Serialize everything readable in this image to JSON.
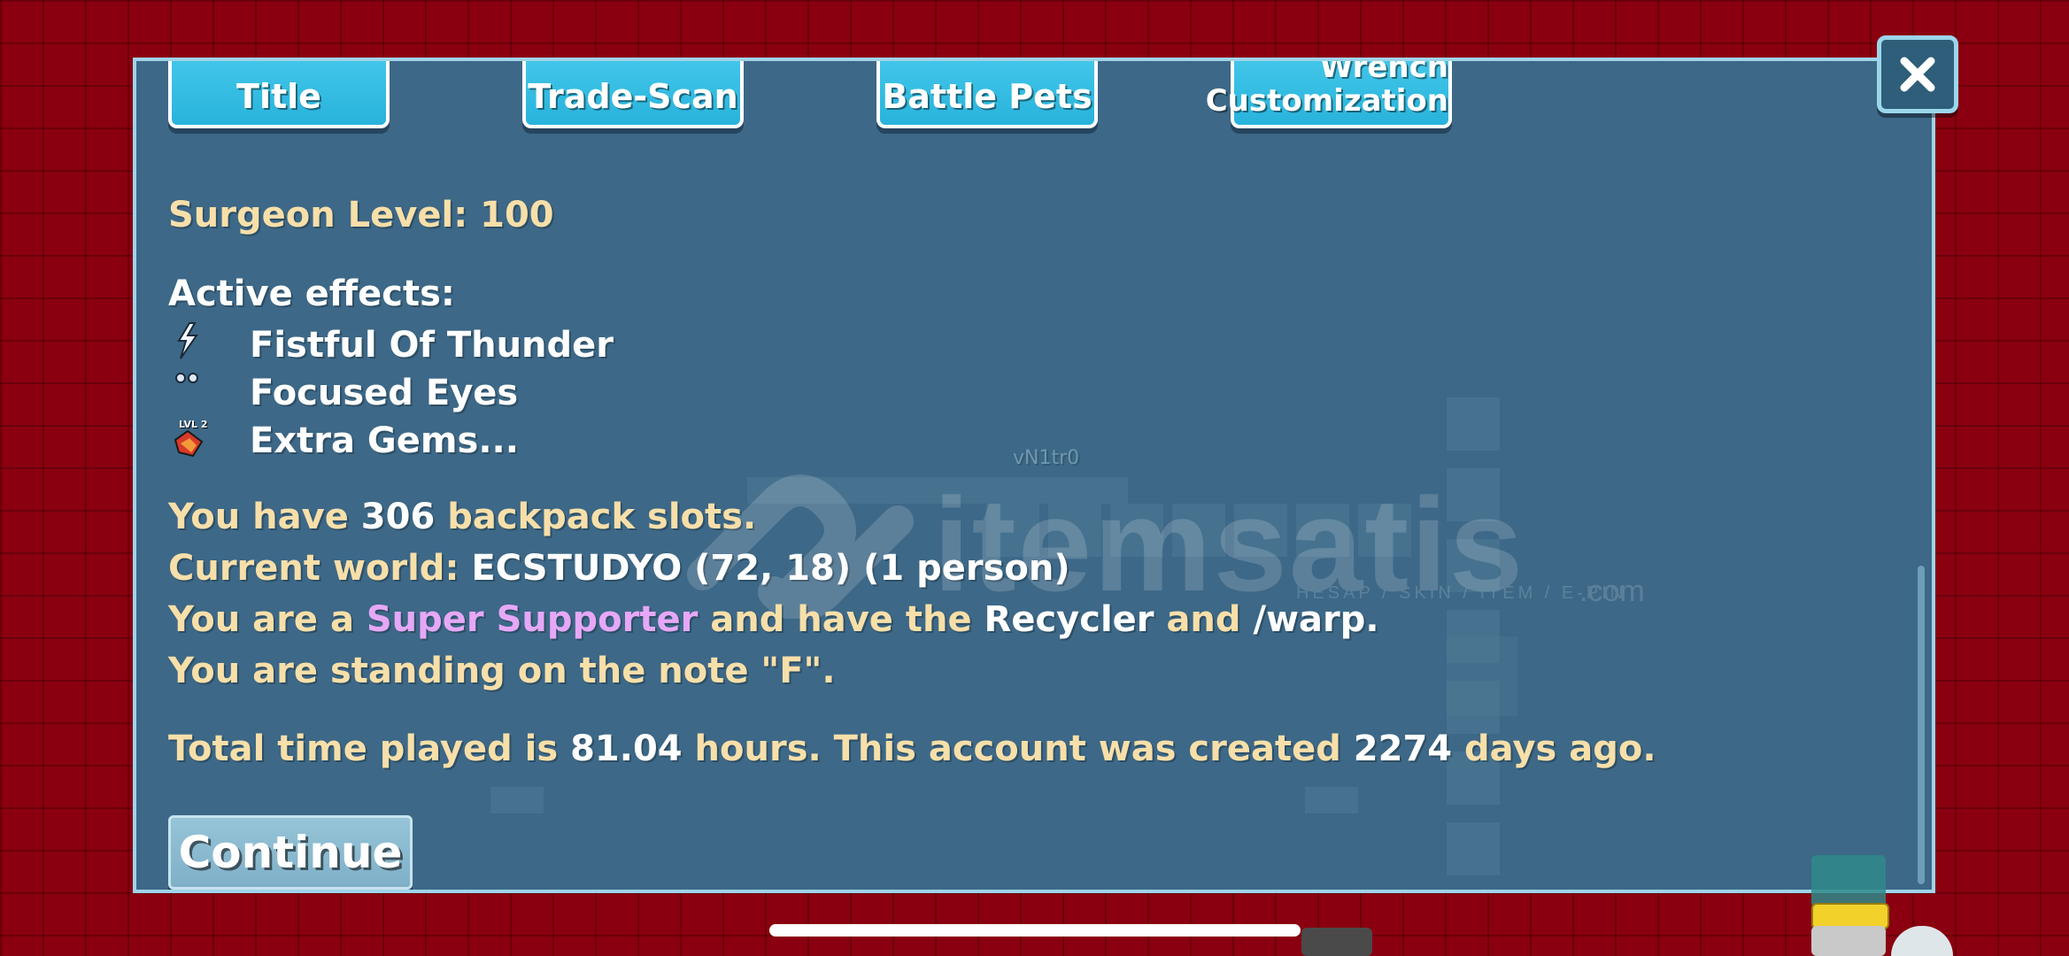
{
  "tabs": {
    "title": "Title",
    "trade_scan": "Trade-Scan",
    "battle_pets": "Battle Pets",
    "wrench_line1": "Wrench",
    "wrench_line2": "Customization"
  },
  "surgeon": {
    "label": "Surgeon Level: 100"
  },
  "active_effects": {
    "heading": "Active effects:",
    "items": [
      {
        "name": "Fistful Of Thunder",
        "icon": "lightning-icon"
      },
      {
        "name": "Focused Eyes",
        "icon": "eyes-icon"
      },
      {
        "name": "Extra Gems...",
        "icon": "gem-lvl2-icon",
        "badge": "LVL 2"
      }
    ]
  },
  "info": {
    "backpack_pre": "You have ",
    "backpack_count": "306",
    "backpack_post": " backpack slots.",
    "world_pre": "Current world: ",
    "world_value": "ECSTUDYO (72, 18) (1 person)",
    "supporter_pre": "You are a ",
    "supporter_rank": "Super Supporter",
    "supporter_mid": " and have the ",
    "supporter_recycler": "Recycler",
    "supporter_and": " and ",
    "supporter_warp": "/warp",
    "supporter_end": ".",
    "note": "You are standing on the note \"F\".",
    "time_pre": "Total time played is ",
    "time_value": "81.04",
    "time_mid": " hours.  This account was created ",
    "days_value": "2274",
    "days_post": " days ago."
  },
  "buttons": {
    "continue": "Continue"
  },
  "watermark": {
    "brand": "itemsatis",
    "tagline": "HESAP / SKIN / ITEM / E-PIN",
    "domain": ".com"
  },
  "scene": {
    "player_name": "vN1tr0"
  },
  "colors": {
    "panel_bg": "#3d6887",
    "panel_border": "#9fd4ea",
    "tab_bg": "#28b3dc",
    "text_gold": "#f7dfa9",
    "text_white": "#ffffff",
    "supporter_purple": "#e6a8f6",
    "world_bg": "#8a0010"
  }
}
